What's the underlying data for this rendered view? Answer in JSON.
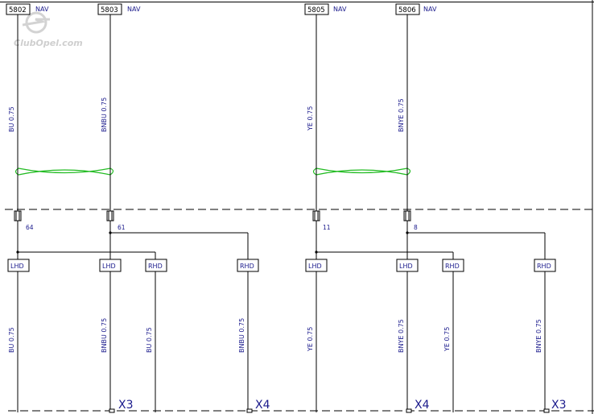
{
  "colors": {
    "wire": "#000000",
    "label_text": "#1a1a8c",
    "box_stroke": "#000000",
    "twist": "#22bb22",
    "watermark": "#c8c8c8"
  },
  "watermark": {
    "text": "ClubOpel.com",
    "icon": "opel-logo-icon"
  },
  "wires": [
    {
      "id": "w5802",
      "circuit": "5802",
      "tag": "NAV",
      "upper_wire": "BU 0.75",
      "splice_pin": "64",
      "branches": [
        {
          "box": "LHD",
          "wire": "BU 0.75"
        },
        {
          "box": "RHD",
          "wire": "BU 0.75"
        }
      ]
    },
    {
      "id": "w5803",
      "circuit": "5803",
      "tag": "NAV",
      "upper_wire": "BNBU 0.75",
      "splice_pin": "61",
      "branches": [
        {
          "box": "LHD",
          "wire": "BNBU 0.75"
        },
        {
          "box": "RHD",
          "wire": "BNBU 0.75"
        }
      ]
    },
    {
      "id": "w5805",
      "circuit": "5805",
      "tag": "NAV",
      "upper_wire": "YE 0.75",
      "splice_pin": "11",
      "branches": [
        {
          "box": "LHD",
          "wire": "YE 0.75"
        },
        {
          "box": "RHD",
          "wire": "YE 0.75"
        }
      ]
    },
    {
      "id": "w5806",
      "circuit": "5806",
      "tag": "NAV",
      "upper_wire": "BNYE 0.75",
      "splice_pin": "8",
      "branches": [
        {
          "box": "LHD",
          "wire": "BNYE 0.75"
        },
        {
          "box": "RHD",
          "wire": "BNYE 0.75"
        }
      ]
    }
  ],
  "connectors": [
    "X3",
    "X4",
    "X4",
    "X3"
  ]
}
